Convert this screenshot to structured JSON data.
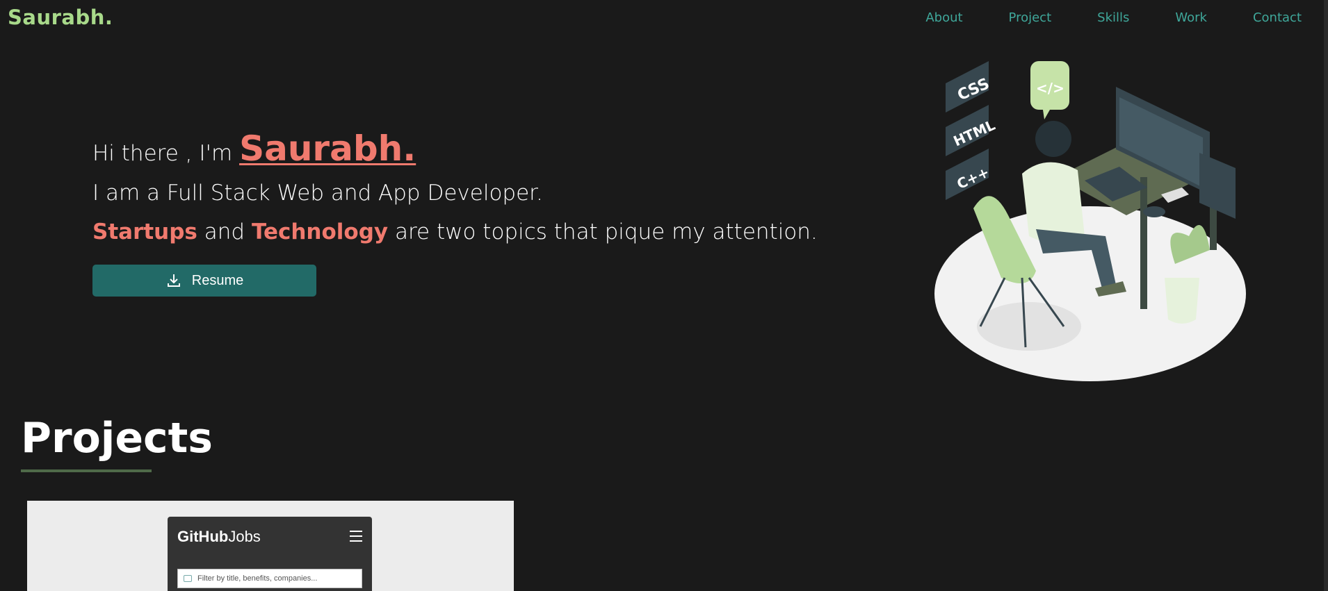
{
  "brand": "Saurabh.",
  "nav": {
    "about": "About",
    "project": "Project",
    "skills": "Skills",
    "work": "Work",
    "contact": "Contact"
  },
  "hero": {
    "greeting": "Hi there , I'm",
    "name": "Saurabh.",
    "role": "I am a Full Stack Web and App Developer.",
    "interest_word1": "Startups",
    "interest_and": "and",
    "interest_word2": "Technology",
    "interest_rest": "are two topics that pique my attention.",
    "resume_label": "Resume"
  },
  "illustration": {
    "tag1": "CSS",
    "tag2": "HTML",
    "tag3": "C++",
    "tag4": "</>"
  },
  "projects": {
    "title": "Projects",
    "card": {
      "app_title_bold": "GitHub",
      "app_title_light": "Jobs",
      "search_placeholder": "Filter by title, benefits, companies..."
    }
  },
  "colors": {
    "background": "#1a1a1a",
    "accent": "#f07a6e",
    "brand": "#a8d98a",
    "nav": "#3fa79a",
    "button": "#226a67"
  }
}
